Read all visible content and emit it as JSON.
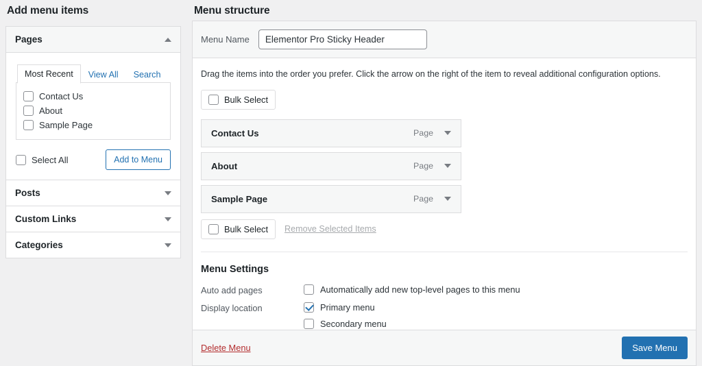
{
  "headings": {
    "add_menu_items": "Add menu items",
    "menu_structure": "Menu structure"
  },
  "sidebar": {
    "panels": [
      {
        "title": "Pages",
        "expanded": true,
        "caret": "caret-up-icon",
        "tabs": [
          {
            "label": "Most Recent",
            "active": true
          },
          {
            "label": "View All",
            "active": false
          },
          {
            "label": "Search",
            "active": false
          }
        ],
        "pages": [
          {
            "label": "Contact Us",
            "checked": false
          },
          {
            "label": "About",
            "checked": false
          },
          {
            "label": "Sample Page",
            "checked": false
          }
        ],
        "select_all_label": "Select All",
        "select_all_checked": false,
        "add_button_label": "Add to Menu"
      },
      {
        "title": "Posts",
        "expanded": false,
        "caret": "caret-down-icon"
      },
      {
        "title": "Custom Links",
        "expanded": false,
        "caret": "caret-down-icon"
      },
      {
        "title": "Categories",
        "expanded": false,
        "caret": "caret-down-icon"
      }
    ]
  },
  "structure": {
    "menu_name_label": "Menu Name",
    "menu_name_value": "Elementor Pro Sticky Header",
    "menu_name_placeholder": "Menu Name",
    "hint": "Drag the items into the order you prefer. Click the arrow on the right of the item to reveal additional configuration options.",
    "bulk_select_top_label": "Bulk Select",
    "bulk_select_top_checked": false,
    "bulk_select_bottom_label": "Bulk Select",
    "bulk_select_bottom_checked": false,
    "remove_selected_label": "Remove Selected Items",
    "items": [
      {
        "title": "Contact Us",
        "type": "Page",
        "caret": "caret-down-icon"
      },
      {
        "title": "About",
        "type": "Page",
        "caret": "caret-down-icon"
      },
      {
        "title": "Sample Page",
        "type": "Page",
        "caret": "caret-down-icon"
      }
    ]
  },
  "settings": {
    "title": "Menu Settings",
    "auto_add_label": "Auto add pages",
    "auto_add_option": "Automatically add new top-level pages to this menu",
    "auto_add_checked": false,
    "display_location_label": "Display location",
    "locations": [
      {
        "label": "Primary menu",
        "checked": true
      },
      {
        "label": "Secondary menu",
        "checked": false
      }
    ]
  },
  "footer": {
    "delete_label": "Delete Menu",
    "save_label": "Save Menu"
  },
  "colors": {
    "accent": "#2271b1",
    "danger": "#b32d2e",
    "page_bg": "#f0f0f1",
    "panel_bg": "#ffffff",
    "row_bg": "#f6f7f7",
    "border": "#dcdcde",
    "muted_text": "#787c82"
  }
}
